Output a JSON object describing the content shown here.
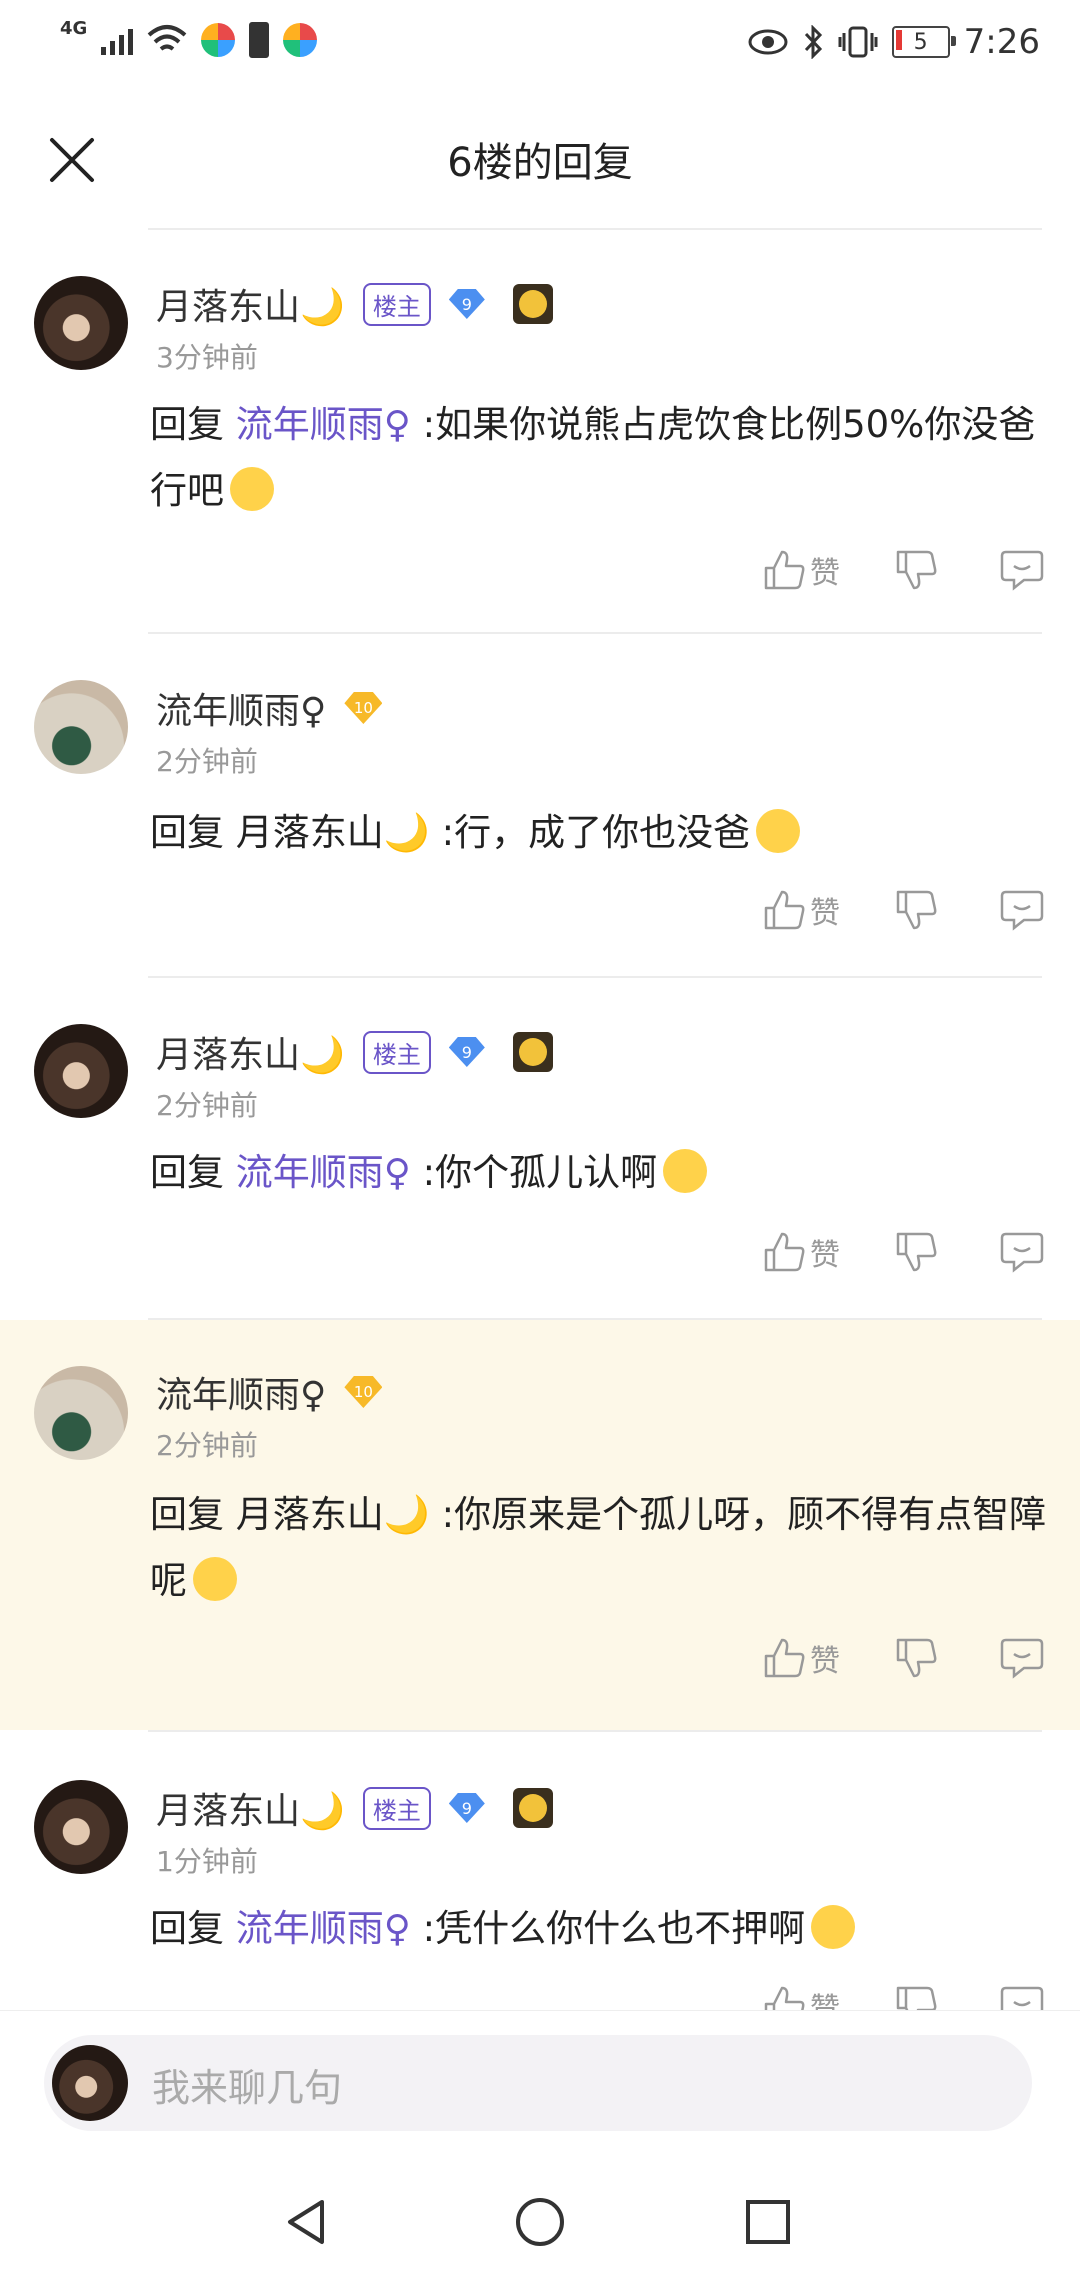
{
  "status_bar": {
    "network": "4G",
    "battery": "5",
    "time": "7:26"
  },
  "header": {
    "title": "6楼的回复"
  },
  "comments": [
    {
      "user": "月落东山🌙",
      "role": "楼主",
      "level": "9",
      "time": "3分钟前",
      "reply_prefix": "回复",
      "reply_to": "流年顺雨♀",
      "text": ":如果你说熊占虎饮食比例50%你没爸行吧"
    },
    {
      "user": "流年顺雨♀",
      "level": "10",
      "time": "2分钟前",
      "reply_prefix": "回复",
      "reply_to": "月落东山🌙",
      "text": ":行，成了你也没爸"
    },
    {
      "user": "月落东山🌙",
      "role": "楼主",
      "level": "9",
      "time": "2分钟前",
      "reply_prefix": "回复",
      "reply_to": "流年顺雨♀",
      "text": ":你个孤儿认啊"
    },
    {
      "user": "流年顺雨♀",
      "level": "10",
      "time": "2分钟前",
      "reply_prefix": "回复",
      "reply_to": "月落东山🌙",
      "text": ":你原来是个孤儿呀，顾不得有点智障呢"
    },
    {
      "user": "月落东山🌙",
      "role": "楼主",
      "level": "9",
      "time": "1分钟前",
      "reply_prefix": "回复",
      "reply_to": "流年顺雨♀",
      "text": ":凭什么你什么也不押啊"
    }
  ],
  "actions": {
    "like": "赞"
  },
  "input": {
    "placeholder": "我来聊几句"
  },
  "icons": [
    "close-icon",
    "thumb-up-icon",
    "thumb-down-icon",
    "comment-icon",
    "back-icon",
    "home-icon",
    "recents-icon"
  ]
}
